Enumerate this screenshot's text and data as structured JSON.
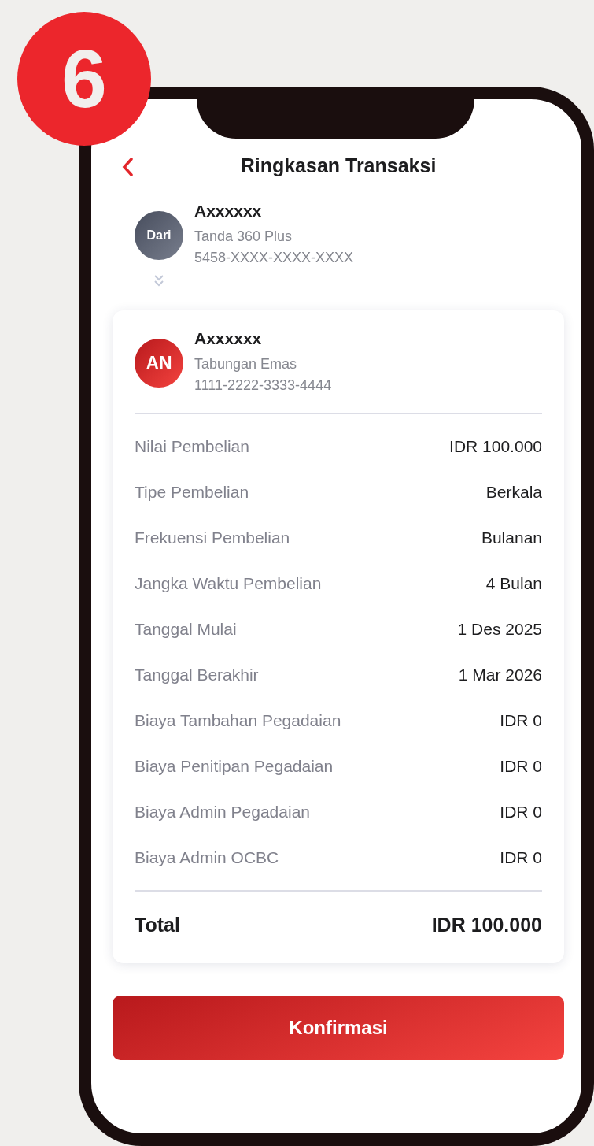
{
  "step_badge": "6",
  "header": {
    "title": "Ringkasan Transaksi"
  },
  "source": {
    "avatar": "Dari",
    "name": "Axxxxxx",
    "product": "Tanda 360 Plus",
    "account": "5458-XXXX-XXXX-XXXX"
  },
  "destination": {
    "avatar": "AN",
    "name": "Axxxxxx",
    "product": "Tabungan Emas",
    "account": "1111-2222-3333-4444"
  },
  "details": [
    {
      "label": "Nilai Pembelian",
      "value": "IDR 100.000"
    },
    {
      "label": "Tipe Pembelian",
      "value": "Berkala"
    },
    {
      "label": "Frekuensi Pembelian",
      "value": "Bulanan"
    },
    {
      "label": "Jangka Waktu Pembelian",
      "value": "4 Bulan"
    },
    {
      "label": "Tanggal Mulai",
      "value": "1 Des 2025"
    },
    {
      "label": "Tanggal Berakhir",
      "value": "1 Mar 2026"
    },
    {
      "label": "Biaya Tambahan Pegadaian",
      "value": "IDR 0"
    },
    {
      "label": "Biaya Penitipan Pegadaian",
      "value": "IDR 0"
    },
    {
      "label": "Biaya Admin Pegadaian",
      "value": "IDR 0"
    },
    {
      "label": "Biaya Admin OCBC",
      "value": "IDR 0"
    }
  ],
  "total": {
    "label": "Total",
    "value": "IDR 100.000"
  },
  "confirm_button": "Konfirmasi"
}
